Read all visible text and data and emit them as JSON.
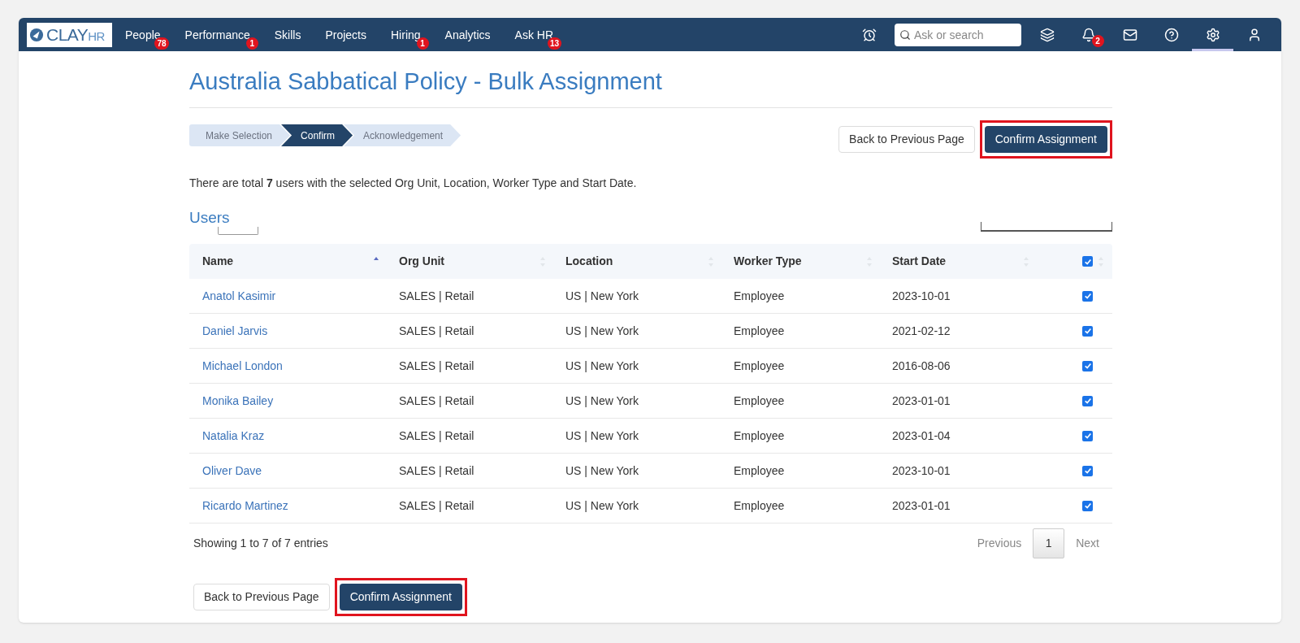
{
  "nav": {
    "logo": {
      "main": "CLAY",
      "sub": "HR"
    },
    "items": [
      {
        "label": "People",
        "badge": "78"
      },
      {
        "label": "Performance",
        "badge": "1"
      },
      {
        "label": "Skills"
      },
      {
        "label": "Projects"
      },
      {
        "label": "Hiring",
        "badge": "1"
      },
      {
        "label": "Analytics"
      },
      {
        "label": "Ask HR",
        "badge": "13"
      }
    ],
    "search": {
      "placeholder": "Ask or search"
    },
    "tools": [
      {
        "kind": "alarm",
        "selected": false
      },
      {
        "kind": "layers",
        "selected": false
      },
      {
        "kind": "bell",
        "badge": "2",
        "selected": false
      },
      {
        "kind": "mail",
        "selected": false
      },
      {
        "kind": "help",
        "selected": false
      },
      {
        "kind": "settings",
        "selected": true
      },
      {
        "kind": "user",
        "selected": false
      }
    ]
  },
  "page": {
    "title": "Australia Sabbatical Policy - Bulk Assignment",
    "steps": [
      {
        "label": "Make Selection",
        "selected": false
      },
      {
        "label": "Confirm",
        "selected": true
      },
      {
        "label": "Acknowledgement",
        "selected": false
      }
    ],
    "summary": "There are total **7** users with the selected Org Unit, Location, Worker Type and Start Date.",
    "buttons_top": [
      {
        "label": "Back to Previous Page",
        "kind": "secondary",
        "highlighted": false
      },
      {
        "label": "Confirm Assignment",
        "kind": "primary",
        "highlighted": true
      }
    ],
    "users": {
      "title": "Users",
      "columns": [
        {
          "label": "Name",
          "sorted": true
        },
        {
          "label": "Org Unit",
          "sorted": false
        },
        {
          "label": "Location",
          "sorted": false
        },
        {
          "label": "Worker Type",
          "sorted": false
        },
        {
          "label": "Start Date",
          "sorted": false
        }
      ],
      "select_all": {
        "checked": true
      },
      "rows": [
        {
          "name": "Anatol Kasimir",
          "org_unit": "SALES | Retail",
          "location": "US | New York",
          "worker_type": "Employee",
          "start_date": "2023-10-01",
          "checked": true
        },
        {
          "name": "Daniel Jarvis",
          "org_unit": "SALES | Retail",
          "location": "US | New York",
          "worker_type": "Employee",
          "start_date": "2021-02-12",
          "checked": true
        },
        {
          "name": "Michael London",
          "org_unit": "SALES | Retail",
          "location": "US | New York",
          "worker_type": "Employee",
          "start_date": "2016-08-06",
          "checked": true
        },
        {
          "name": "Monika Bailey",
          "org_unit": "SALES | Retail",
          "location": "US | New York",
          "worker_type": "Employee",
          "start_date": "2023-01-01",
          "checked": true
        },
        {
          "name": "Natalia Kraz",
          "org_unit": "SALES | Retail",
          "location": "US | New York",
          "worker_type": "Employee",
          "start_date": "2023-01-04",
          "checked": true
        },
        {
          "name": "Oliver Dave",
          "org_unit": "SALES | Retail",
          "location": "US | New York",
          "worker_type": "Employee",
          "start_date": "2023-10-01",
          "checked": true
        },
        {
          "name": "Ricardo Martinez",
          "org_unit": "SALES | Retail",
          "location": "US | New York",
          "worker_type": "Employee",
          "start_date": "2023-01-01",
          "checked": true
        }
      ],
      "info": "Showing 1 to 7 of 7 entries",
      "pagination": {
        "previous": "Previous",
        "pages": [
          {
            "label": "1",
            "selected": true
          }
        ],
        "next": "Next"
      }
    },
    "buttons_bottom": [
      {
        "label": "Back to Previous Page",
        "kind": "secondary",
        "highlighted": false
      },
      {
        "label": "Confirm Assignment",
        "kind": "primary",
        "highlighted": true
      }
    ]
  }
}
